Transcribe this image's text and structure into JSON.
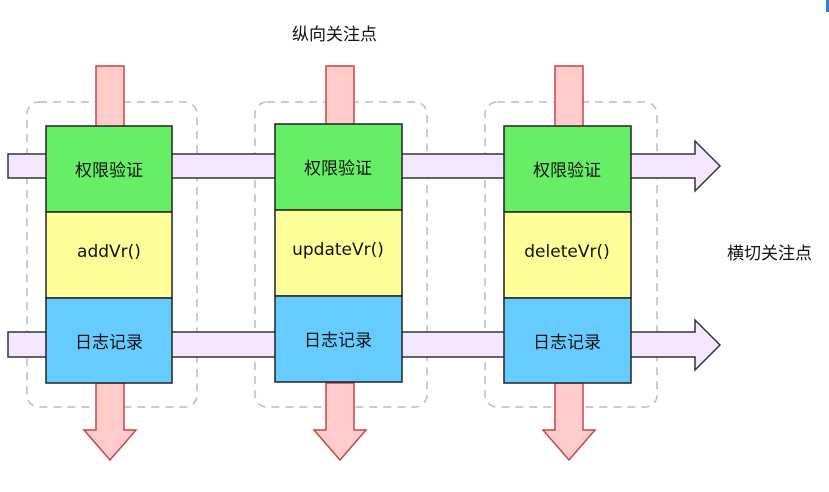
{
  "labels": {
    "vertical_concern": "纵向关注点",
    "horizontal_concern": "横切关注点"
  },
  "columns": [
    {
      "auth": "权限验证",
      "method": "addVr()",
      "log": "日志记录"
    },
    {
      "auth": "权限验证",
      "method": "updateVr()",
      "log": "日志记录"
    },
    {
      "auth": "权限验证",
      "method": "deleteVr()",
      "log": "日志记录"
    }
  ],
  "colors": {
    "auth_fill": "#66ee66",
    "method_fill": "#ffff99",
    "log_fill": "#66ccff",
    "vertical_arrow_fill": "#ffcccc",
    "vertical_arrow_stroke": "#cc4444",
    "horizontal_arrow_fill": "#f5e6ff",
    "horizontal_arrow_stroke": "#333333",
    "group_border": "#bbbbbb",
    "accent": "#2b7fe0"
  }
}
